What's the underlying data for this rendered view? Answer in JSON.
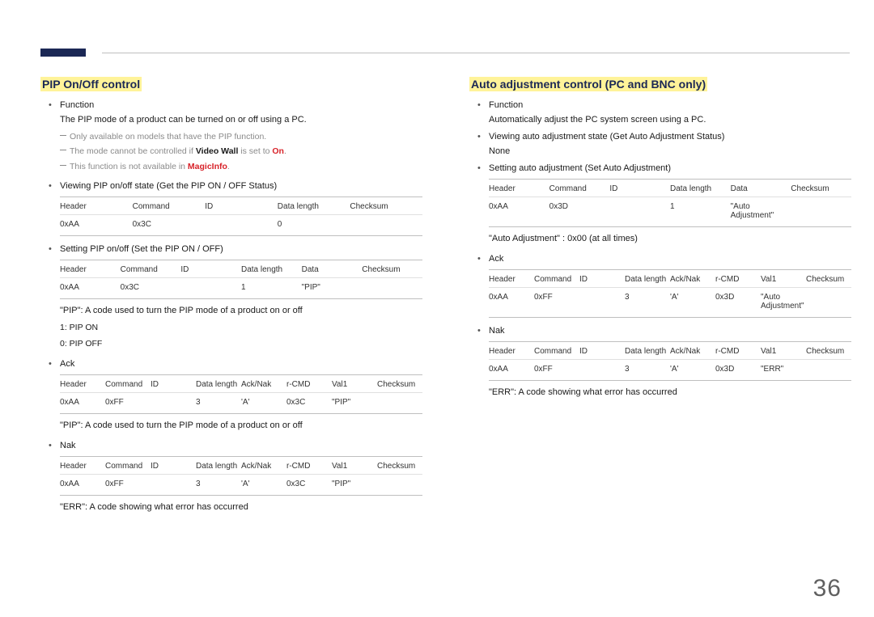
{
  "page_number": "36",
  "left": {
    "title": "PIP On/Off control",
    "b1_label": "Function",
    "b1_desc": "The PIP mode of a product can be turned on or off using a PC.",
    "note1": "Only available on models that have the PIP function.",
    "note2_pre": "The mode cannot be controlled if ",
    "note2_bold1": "Video Wall",
    "note2_mid": " is set to ",
    "note2_bold2": "On",
    "note2_post": ".",
    "note3_pre": "This function is not available in ",
    "note3_bold": "MagicInfo",
    "note3_post": ".",
    "b2": "Viewing PIP on/off state (Get the PIP ON / OFF Status)",
    "t1": {
      "h": [
        "Header",
        "Command",
        "ID",
        "Data length",
        "Checksum"
      ],
      "r": [
        "0xAA",
        "0x3C",
        "",
        "0",
        ""
      ]
    },
    "b3": "Setting PIP on/off (Set the PIP ON / OFF)",
    "t2": {
      "h": [
        "Header",
        "Command",
        "ID",
        "Data length",
        "Data",
        "Checksum"
      ],
      "r": [
        "0xAA",
        "0x3C",
        "",
        "1",
        "\"PIP\"",
        ""
      ]
    },
    "desc1": "\"PIP\": A code used to turn the PIP mode of a product on or off",
    "desc2": "1: PIP ON",
    "desc3": "0: PIP OFF",
    "b4": "Ack",
    "t3": {
      "h": [
        "Header",
        "Command",
        "ID",
        "Data length",
        "Ack/Nak",
        "r-CMD",
        "Val1",
        "Checksum"
      ],
      "r": [
        "0xAA",
        "0xFF",
        "",
        "3",
        "'A'",
        "0x3C",
        "\"PIP\"",
        ""
      ]
    },
    "desc4": "\"PIP\": A code used to turn the PIP mode of a product on or off",
    "b5": "Nak",
    "t4": {
      "h": [
        "Header",
        "Command",
        "ID",
        "Data length",
        "Ack/Nak",
        "r-CMD",
        "Val1",
        "Checksum"
      ],
      "r": [
        "0xAA",
        "0xFF",
        "",
        "3",
        "'A'",
        "0x3C",
        "\"PIP\"",
        ""
      ]
    },
    "desc5": "\"ERR\": A code showing what error has occurred"
  },
  "right": {
    "title": "Auto adjustment control (PC and BNC only)",
    "b1_label": "Function",
    "b1_desc": "Automatically adjust the PC system screen using a PC.",
    "b2": "Viewing auto adjustment state (Get Auto Adjustment Status)",
    "b2_sub": "None",
    "b3": "Setting auto adjustment (Set Auto Adjustment)",
    "t1": {
      "h": [
        "Header",
        "Command",
        "ID",
        "Data length",
        "Data",
        "Checksum"
      ],
      "r": [
        "0xAA",
        "0x3D",
        "",
        "1",
        "\"Auto Adjustment\"",
        ""
      ]
    },
    "desc1": "\"Auto Adjustment\" : 0x00 (at all times)",
    "b4": "Ack",
    "t2": {
      "h": [
        "Header",
        "Command",
        "ID",
        "Data length",
        "Ack/Nak",
        "r-CMD",
        "Val1",
        "Checksum"
      ],
      "r": [
        "0xAA",
        "0xFF",
        "",
        "3",
        "'A'",
        "0x3D",
        "\"Auto Adjustment\"",
        ""
      ]
    },
    "b5": "Nak",
    "t3": {
      "h": [
        "Header",
        "Command",
        "ID",
        "Data length",
        "Ack/Nak",
        "r-CMD",
        "Val1",
        "Checksum"
      ],
      "r": [
        "0xAA",
        "0xFF",
        "",
        "3",
        "'A'",
        "0x3D",
        "\"ERR\"",
        ""
      ]
    },
    "desc2": "\"ERR\": A code showing what error has occurred"
  }
}
